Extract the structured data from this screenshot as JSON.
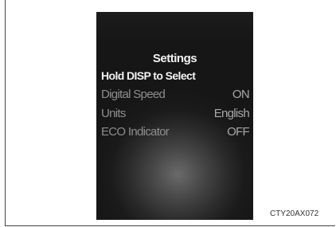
{
  "display": {
    "title": "Settings",
    "subtitle": "Hold DISP to Select",
    "items": [
      {
        "label": "Digital Speed",
        "value": "ON"
      },
      {
        "label": "Units",
        "value": "English"
      },
      {
        "label": "ECO Indicator",
        "value": "OFF"
      }
    ]
  },
  "caption": "CTY20AX072"
}
